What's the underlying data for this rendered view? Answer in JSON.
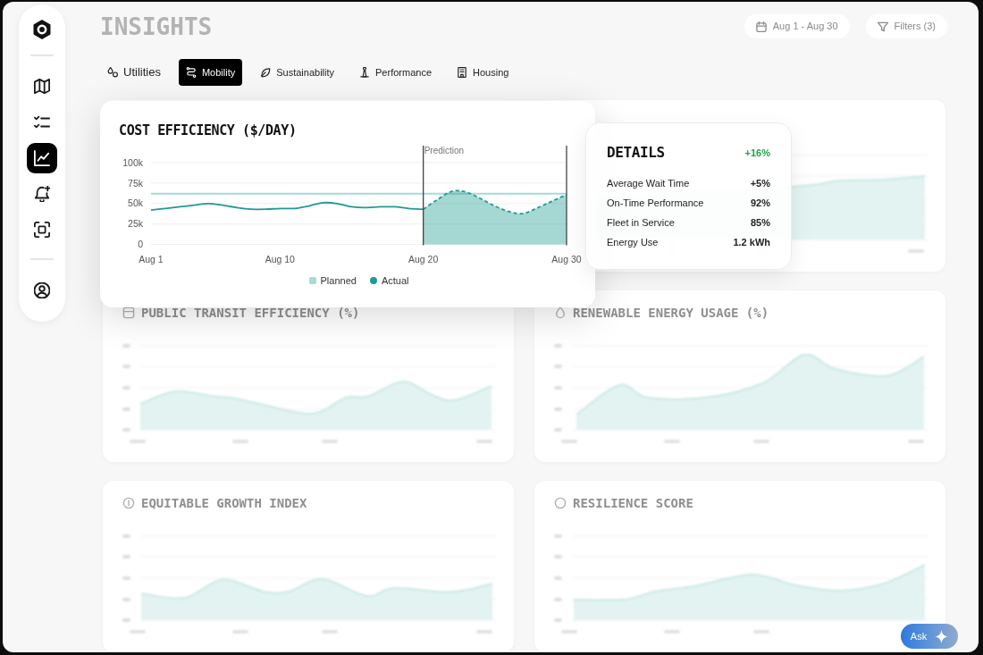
{
  "sidebar": {
    "items": [
      {
        "selected": false
      },
      {
        "selected": false
      },
      {
        "selected": true
      },
      {
        "selected": false
      },
      {
        "selected": false
      }
    ]
  },
  "header": {
    "title": "INSIGHTS",
    "date_range": "Aug 1 - Aug 30",
    "filters": "Filters (3)"
  },
  "tabs": [
    {
      "label": "Utilities",
      "selected": false
    },
    {
      "label": "Mobility",
      "selected": true
    },
    {
      "label": "Sustainability",
      "selected": false
    },
    {
      "label": "Performance",
      "selected": false
    },
    {
      "label": "Housing",
      "selected": false
    }
  ],
  "cost_card": {
    "chart_data": {
      "type": "line",
      "title": "COST EFFICIENCY ($/DAY)",
      "categories": [
        "Aug 1",
        null,
        null,
        null,
        null,
        null,
        null,
        null,
        null,
        "Aug 10",
        null,
        null,
        null,
        null,
        null,
        null,
        null,
        null,
        null,
        "Aug 20",
        null,
        null,
        null,
        null,
        null,
        null,
        null,
        null,
        null,
        "Aug 30"
      ],
      "ylim": [
        0,
        100
      ],
      "yticks": [
        {
          "value": 0,
          "label": "0"
        },
        {
          "value": 25,
          "label": "25k"
        },
        {
          "value": 50,
          "label": "50k"
        },
        {
          "value": 75,
          "label": "75k"
        },
        {
          "value": 100,
          "label": "100k"
        }
      ],
      "grid": true,
      "legend": "bottom",
      "series": [
        {
          "name": "Planned",
          "type": "line",
          "color": "#a6dcd6",
          "values": [
            62,
            62,
            62,
            62,
            62,
            62,
            62,
            62,
            62,
            62,
            62,
            62,
            62,
            62,
            62,
            62,
            62,
            62,
            62,
            62,
            62,
            62,
            62,
            62,
            62,
            62,
            62,
            62,
            62,
            62
          ]
        },
        {
          "name": "Actual",
          "type": "line",
          "color": "#1e9b92",
          "values": [
            42,
            44,
            46,
            48,
            50,
            48,
            45,
            43,
            43,
            44,
            44,
            47,
            51,
            50,
            46,
            45,
            46,
            46,
            44,
            43,
            null,
            null,
            null,
            null,
            null,
            null,
            null,
            null,
            null,
            null
          ]
        },
        {
          "name": "Prediction",
          "type": "area",
          "color": "#1e9b92",
          "values": [
            null,
            null,
            null,
            null,
            null,
            null,
            null,
            null,
            null,
            null,
            null,
            null,
            null,
            null,
            null,
            null,
            null,
            null,
            null,
            43,
            55,
            65,
            64,
            56,
            47,
            40,
            38,
            45,
            53,
            61
          ]
        }
      ]
    }
  },
  "details": {
    "title": "DETAILS",
    "change": "+16%",
    "rows": [
      {
        "label": "Average Wait Time",
        "value": "+5%"
      },
      {
        "label": "On-Time Performance",
        "value": "92%"
      },
      {
        "label": "Fleet in Service",
        "value": "85%"
      },
      {
        "label": "Energy Use",
        "value": "1.2 kWh"
      }
    ]
  },
  "background_cards": [
    {
      "title": "PUBLIC TRANSIT EFFICIENCY (%)"
    },
    {
      "title": "RENEWABLE ENERGY USAGE (%)"
    },
    {
      "title": "EQUITABLE GROWTH INDEX"
    },
    {
      "title": "RESILIENCE SCORE"
    }
  ],
  "ask_button": {
    "label": "Ask"
  }
}
